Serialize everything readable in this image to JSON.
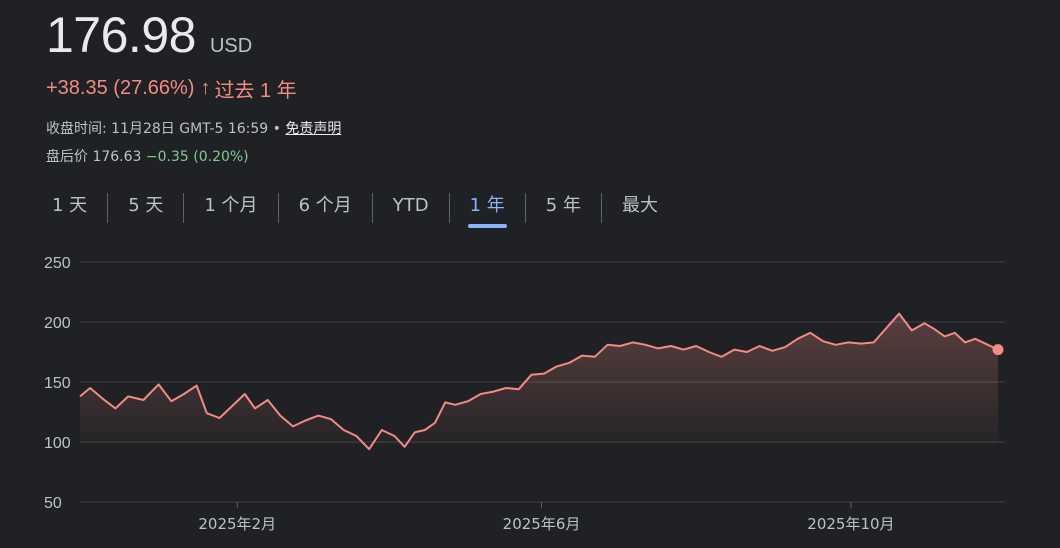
{
  "quote": {
    "price": "176.98",
    "currency": "USD",
    "change": "+38.35 (27.66%)",
    "change_arrow": "↑",
    "change_period": "过去 1 年",
    "close_time": "收盘时间: 11月28日 GMT-5 16:59 •",
    "disclaimer": "免责声明",
    "after_hours_label": "盘后价 176.63",
    "after_hours_change": "−0.35 (0.20%)"
  },
  "tabs": [
    {
      "label": "1 天",
      "active": false
    },
    {
      "label": "5 天",
      "active": false
    },
    {
      "label": "1 个月",
      "active": false
    },
    {
      "label": "6 个月",
      "active": false
    },
    {
      "label": "YTD",
      "active": false
    },
    {
      "label": "1 年",
      "active": true
    },
    {
      "label": "5 年",
      "active": false
    },
    {
      "label": "最大",
      "active": false
    }
  ],
  "colors": {
    "line": "#f28b82",
    "grid": "#3c4043",
    "axis_text": "#bdc1c6",
    "active_tab": "#8ab4f8"
  },
  "chart_data": {
    "type": "area",
    "title": "",
    "xlabel": "",
    "ylabel": "",
    "ylim": [
      50,
      250
    ],
    "yticks": [
      250,
      200,
      150,
      100,
      50
    ],
    "xtick_labels": [
      {
        "label": "2025年2月",
        "x": "2025-02-01"
      },
      {
        "label": "2025年6月",
        "x": "2025-06-01"
      },
      {
        "label": "2025年10月",
        "x": "2025-10-01"
      }
    ],
    "grid": true,
    "series": [
      {
        "x": [
          "2024-12-01",
          "2024-12-05",
          "2024-12-10",
          "2024-12-15",
          "2024-12-20",
          "2024-12-26",
          "2025-01-01",
          "2025-01-06",
          "2025-01-11",
          "2025-01-16",
          "2025-01-20",
          "2025-01-25",
          "2025-01-30",
          "2025-02-04",
          "2025-02-08",
          "2025-02-13",
          "2025-02-18",
          "2025-02-23",
          "2025-02-28",
          "2025-03-05",
          "2025-03-10",
          "2025-03-15",
          "2025-03-20",
          "2025-03-25",
          "2025-03-30",
          "2025-04-04",
          "2025-04-08",
          "2025-04-12",
          "2025-04-16",
          "2025-04-20",
          "2025-04-24",
          "2025-04-28",
          "2025-05-03",
          "2025-05-08",
          "2025-05-13",
          "2025-05-18",
          "2025-05-23",
          "2025-05-28",
          "2025-06-02",
          "2025-06-07",
          "2025-06-12",
          "2025-06-17",
          "2025-06-22",
          "2025-06-27",
          "2025-07-02",
          "2025-07-07",
          "2025-07-12",
          "2025-07-17",
          "2025-07-22",
          "2025-07-27",
          "2025-08-01",
          "2025-08-06",
          "2025-08-11",
          "2025-08-16",
          "2025-08-21",
          "2025-08-26",
          "2025-08-31",
          "2025-09-05",
          "2025-09-10",
          "2025-09-15",
          "2025-09-20",
          "2025-09-25",
          "2025-09-30",
          "2025-10-05",
          "2025-10-10",
          "2025-10-15",
          "2025-10-20",
          "2025-10-25",
          "2025-10-30",
          "2025-11-03",
          "2025-11-07",
          "2025-11-11",
          "2025-11-15",
          "2025-11-19",
          "2025-11-24",
          "2025-11-28"
        ],
        "values": [
          138,
          145,
          136,
          128,
          138,
          135,
          148,
          134,
          140,
          147,
          124,
          120,
          130,
          140,
          128,
          135,
          122,
          113,
          118,
          122,
          119,
          110,
          105,
          94,
          110,
          105,
          96,
          108,
          110,
          116,
          133,
          131,
          134,
          140,
          142,
          145,
          144,
          156,
          157,
          163,
          166,
          172,
          171,
          181,
          180,
          183,
          181,
          178,
          180,
          177,
          180,
          175,
          171,
          177,
          175,
          180,
          176,
          179,
          186,
          191,
          184,
          181,
          183,
          182,
          183,
          195,
          207,
          193,
          199,
          194,
          188,
          191,
          183,
          186,
          181,
          176.98
        ]
      }
    ]
  }
}
